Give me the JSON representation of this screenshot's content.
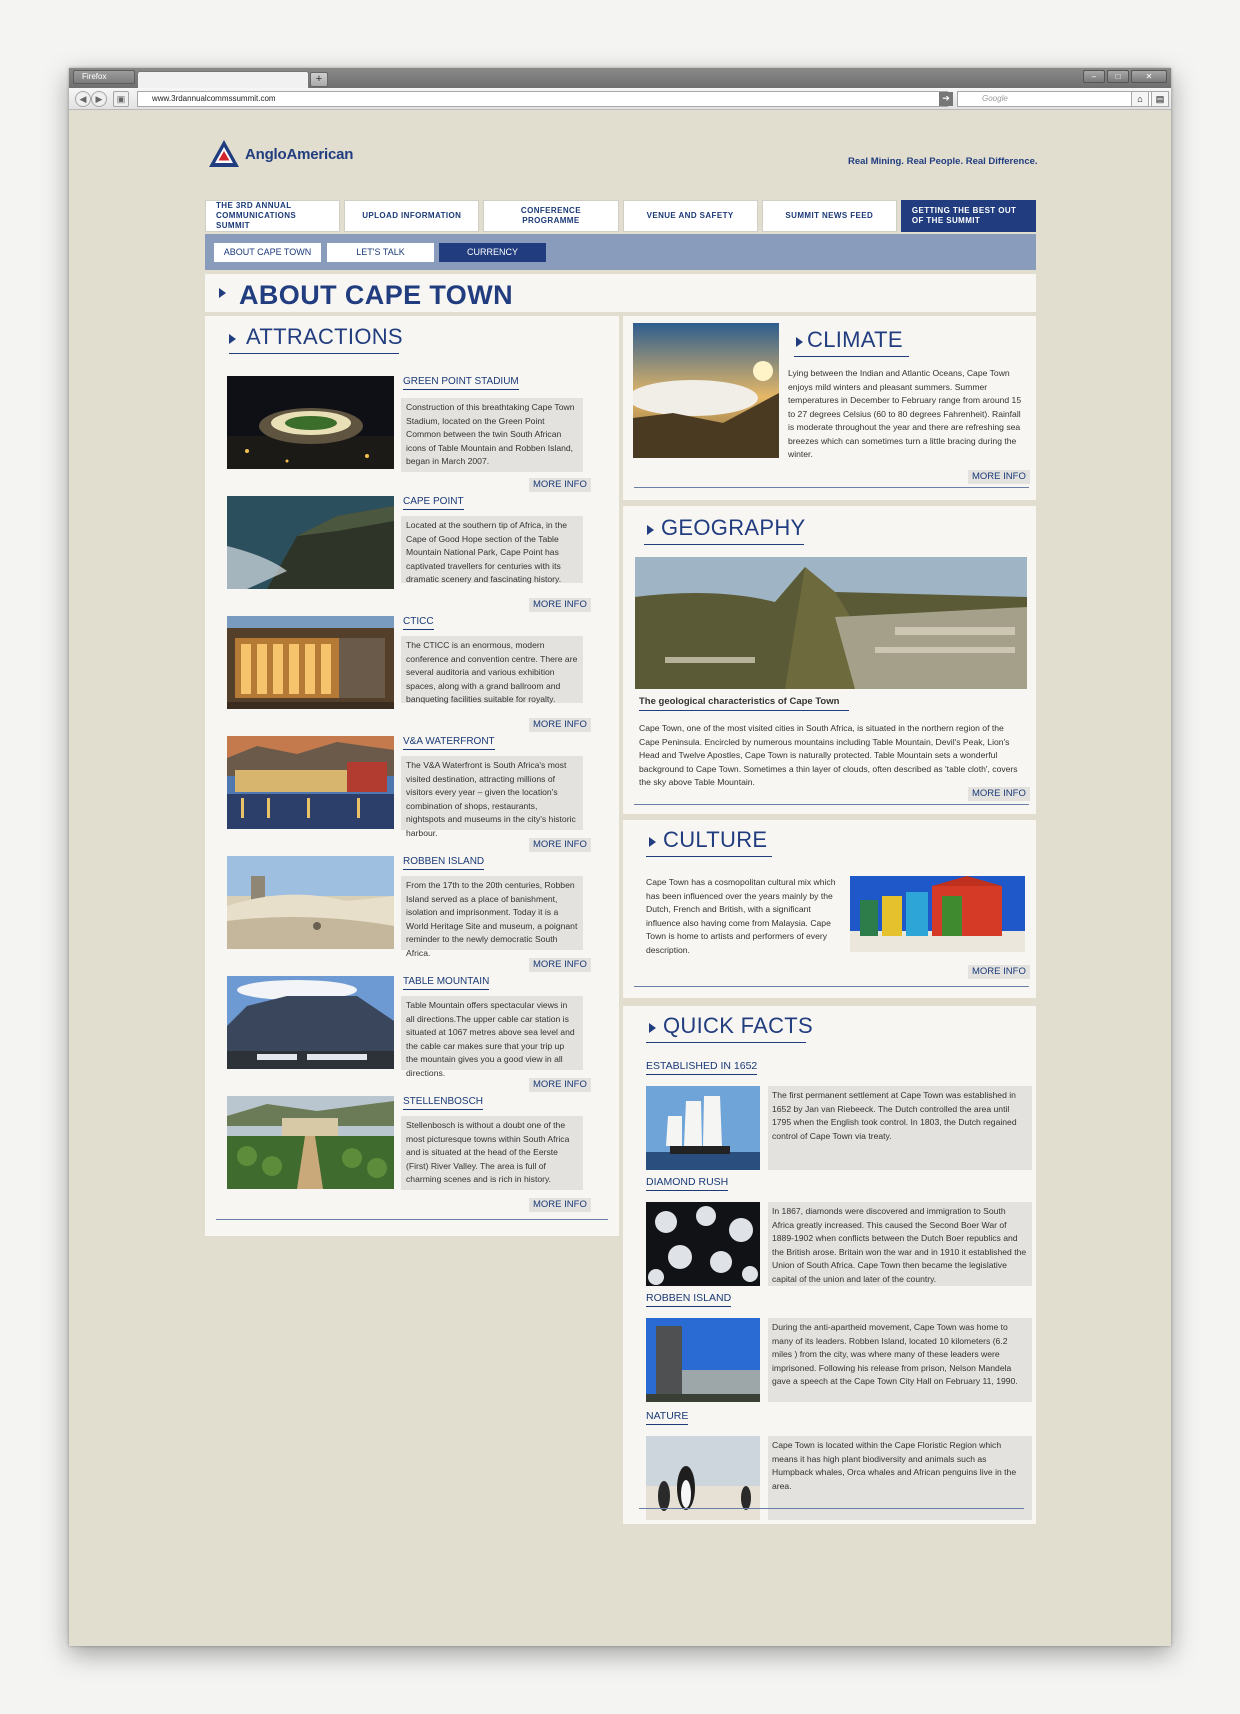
{
  "browser": {
    "app_button": "Firefox",
    "new_tab": "+",
    "url": "www.3rdannualcommssummit.com",
    "search_placeholder": "Google"
  },
  "header": {
    "logo_text": "AngloAmerican",
    "tagline": "Real Mining. Real People. Real Difference."
  },
  "main_nav": [
    "THE 3RD ANNUAL COMMUNICATIONS SUMMIT",
    "UPLOAD INFORMATION",
    "CONFERENCE PROGRAMME",
    "VENUE AND SAFETY",
    "SUMMIT NEWS FEED",
    "GETTING THE BEST OUT OF THE SUMMIT"
  ],
  "sub_nav": [
    "ABOUT CAPE TOWN",
    "LET'S TALK",
    "CURRENCY"
  ],
  "page_title": "ABOUT CAPE TOWN",
  "attractions": {
    "heading": "ATTRACTIONS",
    "more_label": "MORE INFO",
    "items": [
      {
        "title": "GREEN POINT STADIUM",
        "desc": "Construction of this breathtaking Cape Town Stadium, located on the Green Point Common between the twin South African icons of Table Mountain and Robben Island, began in March 2007."
      },
      {
        "title": "CAPE POINT",
        "desc": "Located at the southern tip of Africa, in the Cape of Good Hope section of the Table Mountain National Park, Cape Point has captivated travellers for centuries with its dramatic scenery and fascinating history."
      },
      {
        "title": "CTICC",
        "desc": "The CTICC is an enormous, modern conference and convention centre. There are several auditoria and various exhibition spaces, along with a grand ballroom and banqueting facilities suitable for royalty."
      },
      {
        "title": "V&A WATERFRONT",
        "desc": "The V&A Waterfront is South Africa's most visited destination, attracting millions of visitors every year – given the location's combination of shops, restaurants, nightspots and museums in the city's historic harbour."
      },
      {
        "title": "ROBBEN ISLAND",
        "desc": "From the 17th to the 20th centuries, Robben Island served as a place of banishment, isolation and imprisonment. Today it is a World Heritage Site and museum, a poignant reminder to the newly democratic South Africa."
      },
      {
        "title": "TABLE MOUNTAIN",
        "desc": "Table Mountain offers spectacular views in all directions.The upper cable car station is situated at 1067 metres above sea level and the cable car makes sure that your trip up the mountain gives you a good view in all directions."
      },
      {
        "title": "STELLENBOSCH",
        "desc": "Stellenbosch is without a doubt one of the most picturesque towns within South Africa and is situated at the head of the Eerste (First) River Valley. The area is full of charming scenes and is rich in history."
      }
    ]
  },
  "climate": {
    "heading": "CLIMATE",
    "text": "Lying between the Indian and Atlantic Oceans, Cape Town enjoys mild winters and pleasant summers. Summer temperatures in December to February range from around 15 to 27 degrees Celsius (60 to 80 degrees Fahrenheit). Rainfall is moderate throughout the year and there are refreshing sea breezes which can sometimes turn a little bracing during the winter.",
    "more": "MORE INFO"
  },
  "geography": {
    "heading": "GEOGRAPHY",
    "caption": "The geological characteristics of Cape Town",
    "text": "Cape Town, one of the most visited cities in South Africa, is situated in the northern region of the Cape Peninsula. Encircled by numerous mountains including Table Mountain, Devil's Peak, Lion's Head and Twelve Apostles, Cape Town is naturally protected. Table Mountain sets a wonderful background to Cape Town. Sometimes a thin layer of clouds, often described as 'table cloth', covers the sky above Table Mountain.",
    "more": "MORE INFO"
  },
  "culture": {
    "heading": "CULTURE",
    "text": "Cape Town has a cosmopolitan cultural mix which has been influenced over the years mainly by the Dutch, French and British, with a significant influence also having come from Malaysia. Cape Town is home to artists and performers of every description.",
    "more": "MORE INFO"
  },
  "quick_facts": {
    "heading": "QUICK FACTS",
    "items": [
      {
        "title": "ESTABLISHED IN 1652",
        "desc": "The first permanent settlement at Cape Town was established in 1652 by Jan van Riebeeck. The Dutch controlled the area until 1795 when the English took control. In 1803, the Dutch regained control of Cape Town via treaty."
      },
      {
        "title": "DIAMOND RUSH",
        "desc": "In 1867, diamonds were discovered and immigration to South Africa greatly increased. This caused the Second Boer War of 1889-1902 when conflicts between the Dutch Boer republics and the British arose. Britain won the war and in 1910 it established the Union of South Africa. Cape Town then became the legislative capital of the union and later of the country."
      },
      {
        "title": "ROBBEN ISLAND",
        "desc": "During the anti-apartheid movement, Cape Town was home to many of its leaders. Robben Island, located 10 kilometers (6.2 miles ) from the city, was where many of these leaders were imprisoned. Following his release from prison, Nelson Mandela gave a speech at the Cape Town City Hall on February 11, 1990."
      },
      {
        "title": "NATURE",
        "desc": "Cape Town is located within the Cape Floristic Region which means it has high plant biodiversity and animals such as Humpback whales, Orca whales and African penguins live in the area."
      }
    ]
  }
}
